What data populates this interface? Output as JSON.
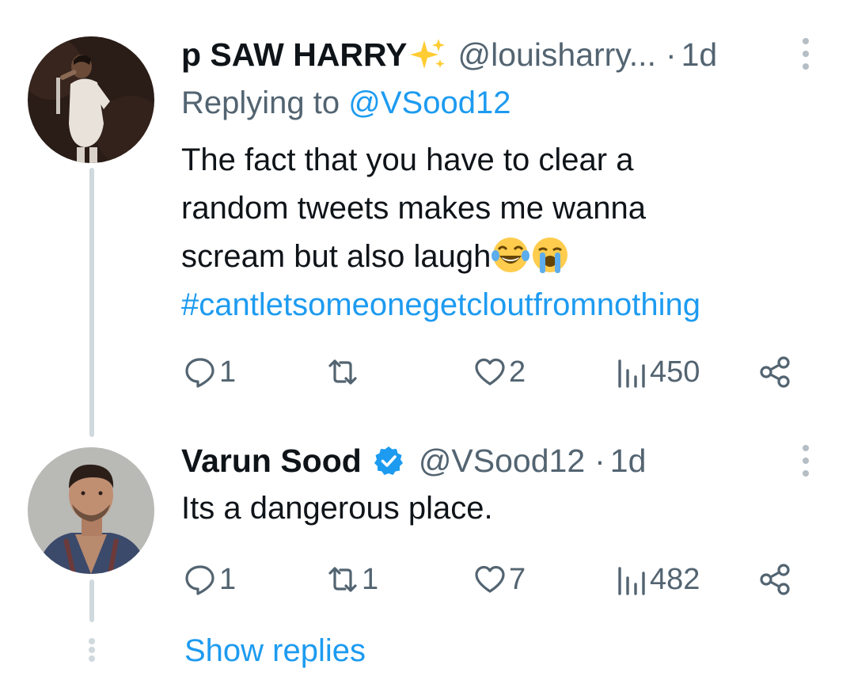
{
  "tweets": [
    {
      "display_name": "p SAW HARRY",
      "handle": "@louisharry...",
      "separator": "·",
      "time": "1d",
      "replying_prefix": "Replying to",
      "replying_handle": "@VSood12",
      "text_lines": [
        "The fact that you have to clear a",
        "random tweets makes me wanna",
        "scream but also laugh"
      ],
      "hashtag": "#cantletsomeonegetcloutfromnothing",
      "stats": {
        "replies": "1",
        "retweets": "",
        "likes": "2",
        "views": "450"
      },
      "icons": [
        "sparkles-icon",
        "joy-emoji-icon",
        "sob-emoji-icon"
      ]
    },
    {
      "display_name": "Varun Sood",
      "handle": "@VSood12",
      "separator": "·",
      "time": "1d",
      "verified": true,
      "text": "Its a dangerous place.",
      "stats": {
        "replies": "1",
        "retweets": "1",
        "likes": "7",
        "views": "482"
      }
    }
  ],
  "show_replies_label": "Show replies",
  "colors": {
    "link": "#1d9bf0",
    "secondary_text": "#536471",
    "thread_line": "#cfd9de",
    "verified_badge": "#1d9bf0"
  }
}
